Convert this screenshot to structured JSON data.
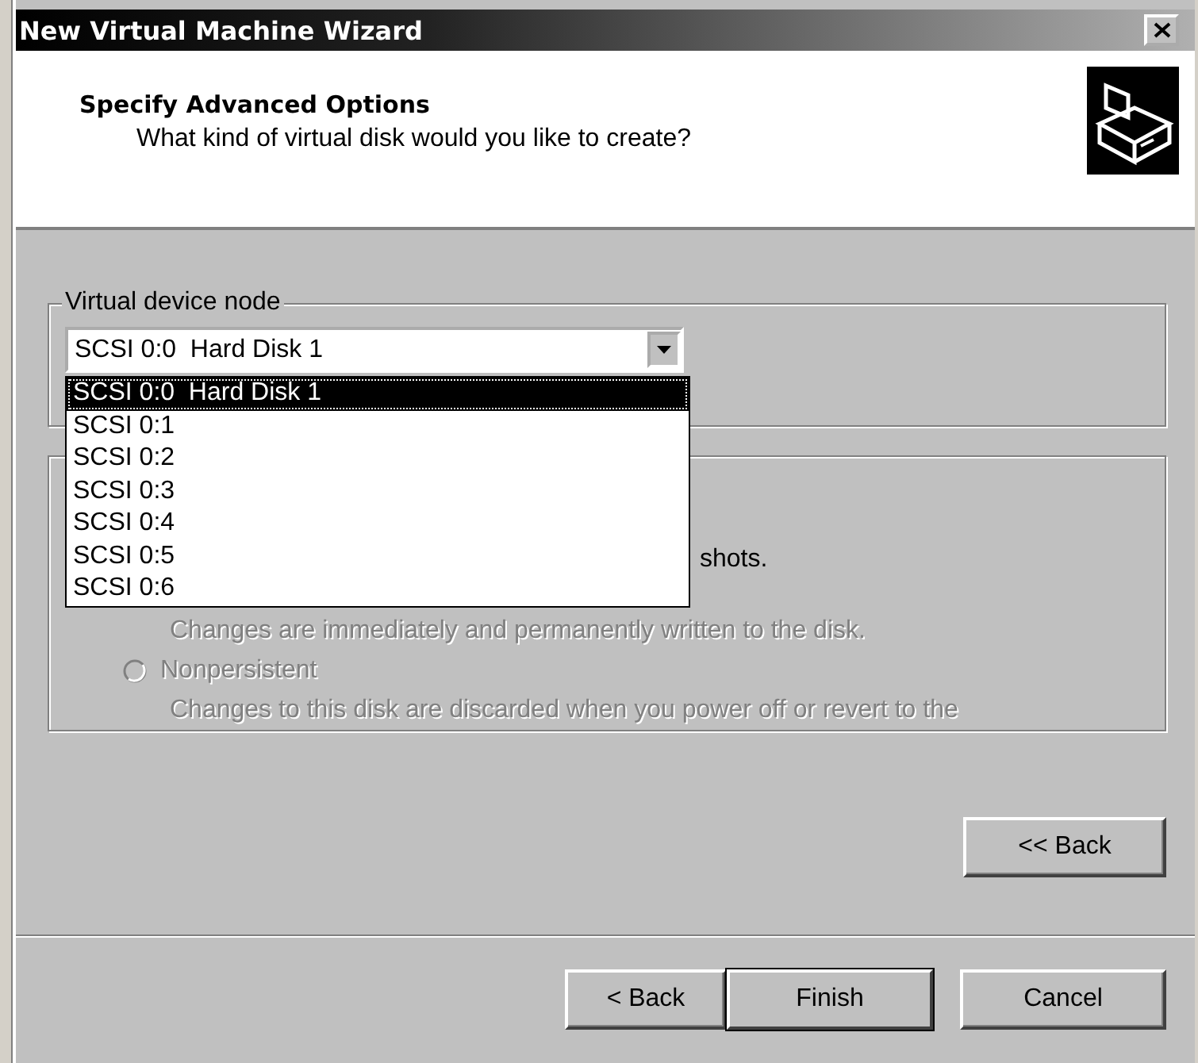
{
  "window": {
    "title": "New Virtual Machine Wizard"
  },
  "header": {
    "title": "Specify Advanced Options",
    "subtitle": "What kind of virtual disk would you like to create?"
  },
  "device_group": {
    "label": "Virtual device node",
    "combo": {
      "value": "SCSI 0:0  Hard Disk 1",
      "expanded": true
    },
    "options": [
      {
        "label": "SCSI 0:0  Hard Disk 1",
        "selected": true
      },
      {
        "label": "SCSI 0:1",
        "selected": false
      },
      {
        "label": "SCSI 0:2",
        "selected": false
      },
      {
        "label": "SCSI 0:3",
        "selected": false
      },
      {
        "label": "SCSI 0:4",
        "selected": false
      },
      {
        "label": "SCSI 0:5",
        "selected": false
      },
      {
        "label": "SCSI 0:6",
        "selected": false
      }
    ]
  },
  "mode_group": {
    "lines": [
      {
        "kind": "partial",
        "text": "shots.",
        "disabled": false
      },
      {
        "kind": "text",
        "text": "Changes are immediately and permanently written to the disk.",
        "disabled": true
      },
      {
        "kind": "radio",
        "text": "Nonpersistent",
        "checked": false,
        "disabled": true
      },
      {
        "kind": "text",
        "text": "Changes to this disk are discarded when you power off or revert to the",
        "disabled": true
      }
    ]
  },
  "inner_button": {
    "label": "<< Back"
  },
  "footer_buttons": [
    {
      "label": "< Back",
      "default": false
    },
    {
      "label": "Finish",
      "default": true
    },
    {
      "label": "Cancel",
      "default": false
    }
  ]
}
